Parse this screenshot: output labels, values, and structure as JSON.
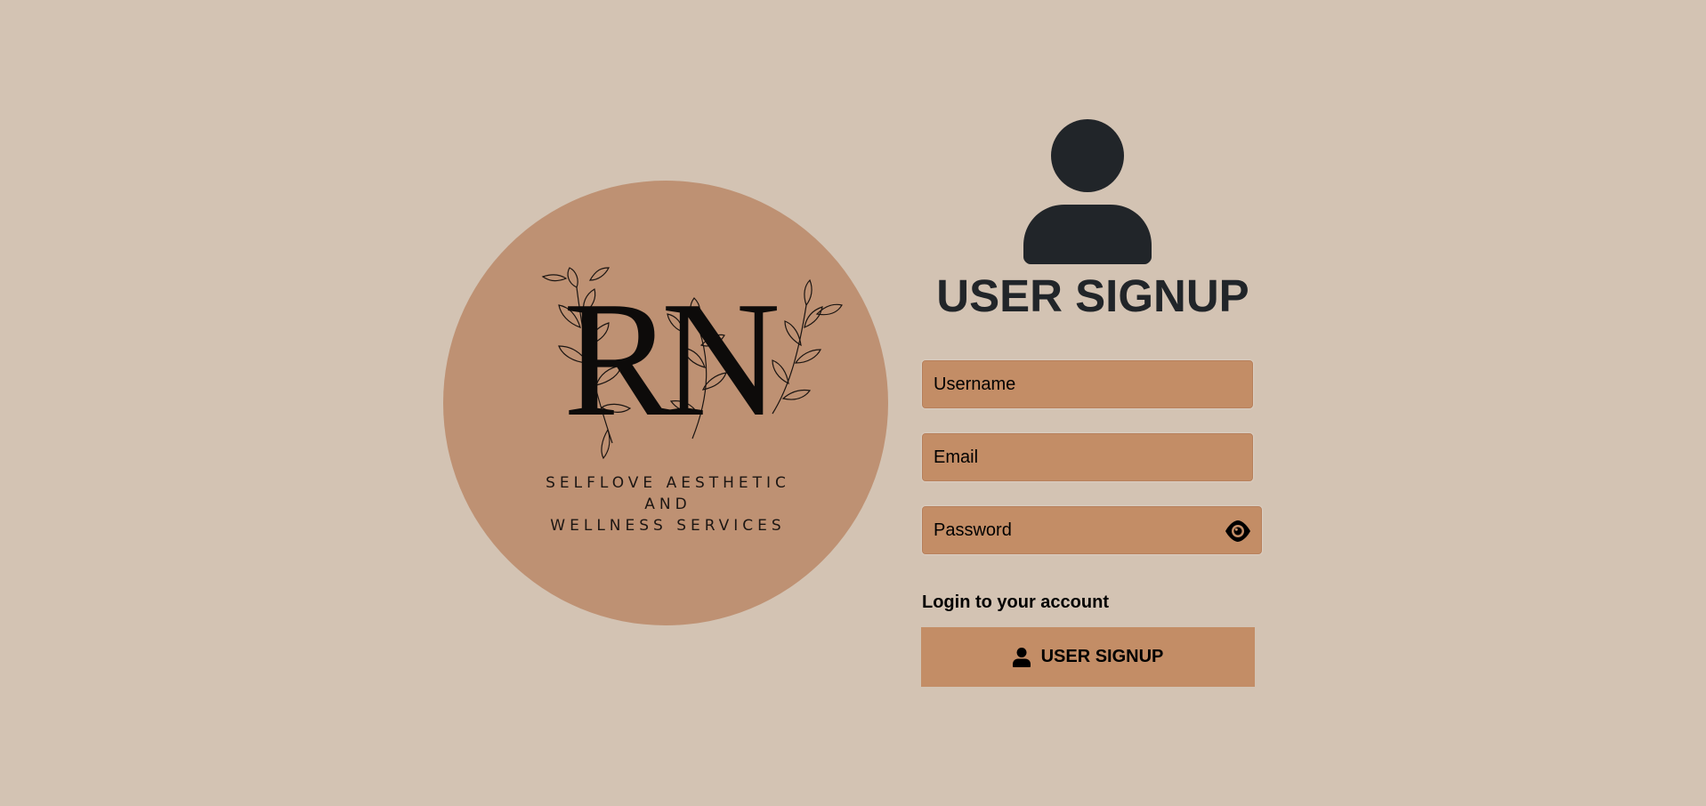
{
  "logo": {
    "monogram": "RN",
    "tagline_lines": [
      "SELFLOVE AESTHETIC",
      "AND",
      "WELLNESS SERVICES"
    ],
    "icon": "rn-leaf-monogram-logo",
    "color": "#be9173"
  },
  "signup": {
    "avatar_icon": "user-icon",
    "title": "USER SIGNUP",
    "username_placeholder": "Username",
    "email_placeholder": "Email",
    "password_placeholder": "Password",
    "password_toggle_icon": "eye-icon",
    "login_link": "Login to your account",
    "submit_label": "USER SIGNUP",
    "submit_icon": "user-icon"
  },
  "colors": {
    "background": "#d3c3b3",
    "accent": "#c38d66",
    "text_dark": "#212529"
  }
}
